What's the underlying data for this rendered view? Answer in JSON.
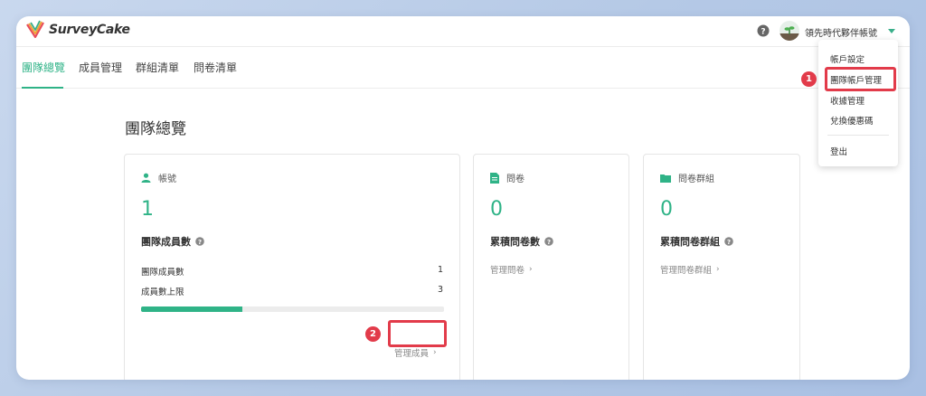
{
  "app": {
    "logo_text": "SurveyCake"
  },
  "header": {
    "account_name": "領先時代夥伴帳號"
  },
  "tabs": [
    {
      "label": "團隊總覽",
      "active": true
    },
    {
      "label": "成員管理",
      "active": false
    },
    {
      "label": "群組清單",
      "active": false
    },
    {
      "label": "問卷清單",
      "active": false
    }
  ],
  "page": {
    "title": "團隊總覽"
  },
  "cards": {
    "accounts": {
      "header": "帳號",
      "value": "1",
      "metric_label": "團隊成員數",
      "rows": [
        {
          "label": "團隊成員數",
          "value": "1"
        },
        {
          "label": "成員數上限",
          "value": "3"
        }
      ],
      "progress_fraction": 0.333,
      "link": "管理成員"
    },
    "surveys": {
      "header": "問卷",
      "value": "0",
      "metric_label": "累積問卷數",
      "link": "管理問卷"
    },
    "survey_groups": {
      "header": "問卷群組",
      "value": "0",
      "metric_label": "累積問卷群組",
      "link": "管理問卷群組"
    }
  },
  "dropdown": {
    "items": [
      "帳戶設定",
      "團隊帳戶管理",
      "收據管理",
      "兌換優惠碼"
    ],
    "logout": "登出"
  },
  "annotations": {
    "step1": "1",
    "step2": "2",
    "color": "#e23b4a"
  },
  "colors": {
    "accent": "#2fb387"
  }
}
